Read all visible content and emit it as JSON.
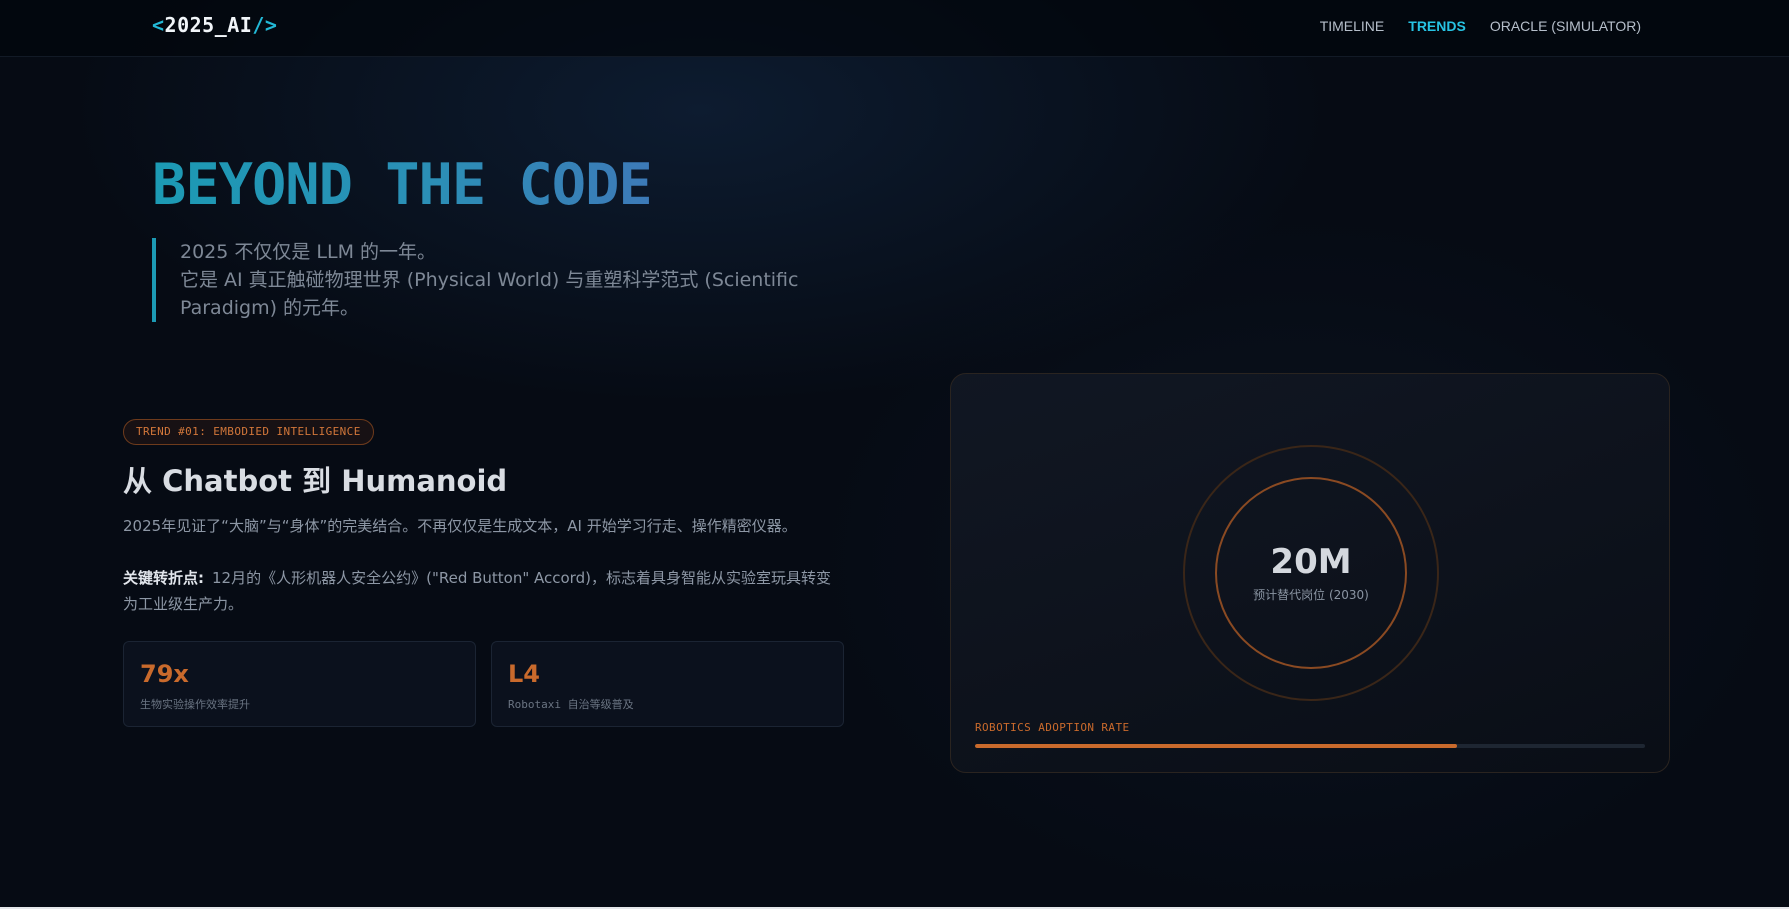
{
  "header": {
    "logo_open": "<",
    "logo_text": "2025_AI",
    "logo_close": "/>",
    "nav": [
      {
        "label": "TIMELINE",
        "active": false
      },
      {
        "label": "TRENDS",
        "active": true
      },
      {
        "label": "ORACLE (SIMULATOR)",
        "active": false
      }
    ]
  },
  "hero": {
    "title": "BEYOND THE CODE",
    "subtitle_line1": "2025 不仅仅是 LLM 的一年。",
    "subtitle_line2": "它是 AI 真正触碰物理世界 (Physical World) 与重塑科学范式 (Scientific Paradigm) 的元年。"
  },
  "trend": {
    "badge": "TREND #01: EMBODIED INTELLIGENCE",
    "title": "从 Chatbot 到 Humanoid",
    "description": "2025年见证了“大脑”与“身体”的完美结合。不再仅仅是生成文本，AI 开始学习行走、操作精密仪器。",
    "key_label": "关键转折点:",
    "key_text": "12月的《人形机器人安全公约》(\"Red Button\" Accord)，标志着具身智能从实验室玩具转变为工业级生产力。",
    "stats": [
      {
        "value": "79x",
        "label": "生物实验操作效率提升"
      },
      {
        "value": "L4",
        "label": "Robotaxi 自治等级普及"
      }
    ]
  },
  "panel": {
    "ring_value": "20M",
    "ring_label": "预计替代岗位 (2030)",
    "adoption_label": "ROBOTICS ADOPTION RATE",
    "adoption_rate": 0.72
  },
  "colors": {
    "accent_cyan": "#27c3e3",
    "accent_orange": "#c96a2c",
    "background": "#060b14"
  }
}
